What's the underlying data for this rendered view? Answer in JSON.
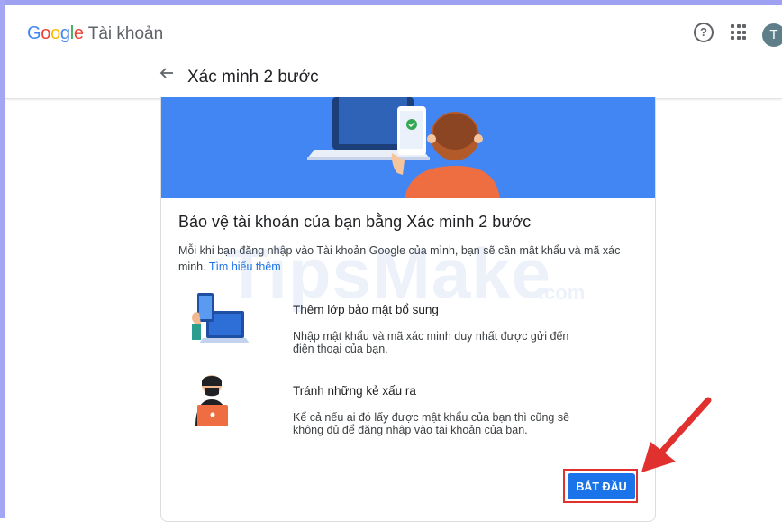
{
  "header": {
    "logo_letters": [
      "G",
      "o",
      "o",
      "g",
      "l",
      "e"
    ],
    "brand_suffix": "Tài khoản",
    "help_icon": "help-circle-icon",
    "apps_icon": "apps-grid-icon",
    "avatar_letter": "T",
    "avatar_color": "#5e7f89"
  },
  "subheader": {
    "back_icon": "arrow-back-icon",
    "title": "Xác minh 2 bước"
  },
  "card": {
    "hero_color": "#4286f4",
    "heading": "Bảo vệ tài khoản của bạn bằng Xác minh 2 bước",
    "description": "Mỗi khi bạn đăng nhập vào Tài khoản Google của mình, bạn sẽ cần mật khẩu và mã xác minh.",
    "learn_more": "Tìm hiểu thêm",
    "features": [
      {
        "icon": "phone-laptop-illustration",
        "title": "Thêm lớp bảo mật bổ sung",
        "text": "Nhập mật khẩu và mã xác minh duy nhất được gửi đến điện thoại của bạn."
      },
      {
        "icon": "hacker-illustration",
        "title": "Tránh những kẻ xấu ra",
        "text": "Kể cả nếu ai đó lấy được mật khẩu của bạn thì cũng sẽ không đủ để đăng nhập vào tài khoản của bạn."
      }
    ],
    "start_button": "BẮT ĐẦU",
    "accent_color": "#1a73e8"
  },
  "watermark": {
    "text": "TipsMake",
    "suffix": ".com"
  },
  "annotation": {
    "highlight_color": "#e0312f"
  }
}
